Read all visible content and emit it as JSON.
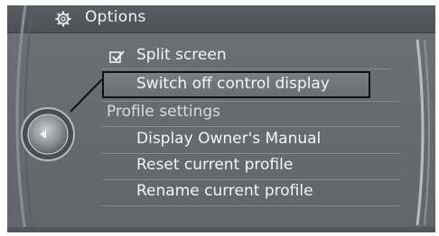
{
  "header": {
    "title": "Options",
    "icon": "gear-icon"
  },
  "menu": {
    "split_screen": {
      "label": "Split screen",
      "checked": true,
      "icon": "checkbox-checked-icon"
    },
    "switch_off_display": {
      "label": "Switch off control display",
      "selected": true
    },
    "profile_section_label": "Profile settings",
    "profile_items": [
      {
        "label": "Display Owner's Manual"
      },
      {
        "label": "Reset current profile"
      },
      {
        "label": "Rename current profile"
      }
    ]
  },
  "controller": {
    "icon": "controller-knob-icon",
    "arrow_icon": "left-arrow-icon"
  },
  "colors": {
    "screen_bg": "#6d7175",
    "title_bar": "#4d5155",
    "text": "#f4f4f4",
    "highlight_border": "#111111"
  }
}
